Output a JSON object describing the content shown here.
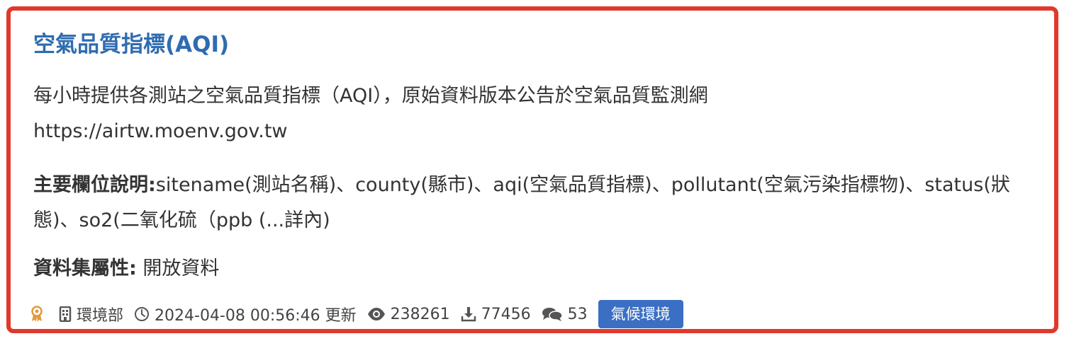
{
  "dataset": {
    "title": "空氣品質指標(AQI)",
    "description_line1": "每小時提供各測站之空氣品質指標（AQI），原始資料版本公告於空氣品質監測網",
    "description_line2": "https://airtw.moenv.gov.tw",
    "fields_label": "主要欄位說明:",
    "fields_value": "sitename(測站名稱)、county(縣市)、aqi(空氣品質指標)、pollutant(空氣污染指標物)、status(狀態)、so2(二氧化硫（ppb (...詳內)",
    "attribute_label": "資料集屬性:",
    "attribute_value": " 開放資料",
    "meta": {
      "agency": "環境部",
      "updated": "2024-04-08 00:56:46 更新",
      "views": "238261",
      "downloads": "77456",
      "comments": "53",
      "tag": "氣候環境"
    }
  },
  "colors": {
    "border": "#e0392b",
    "title": "#2f6cb0",
    "tag_bg": "#3a6fc4",
    "award_icon": "#e09a3c"
  },
  "icons": [
    "award-icon",
    "building-icon",
    "clock-icon",
    "eye-icon",
    "download-icon",
    "comments-icon"
  ]
}
